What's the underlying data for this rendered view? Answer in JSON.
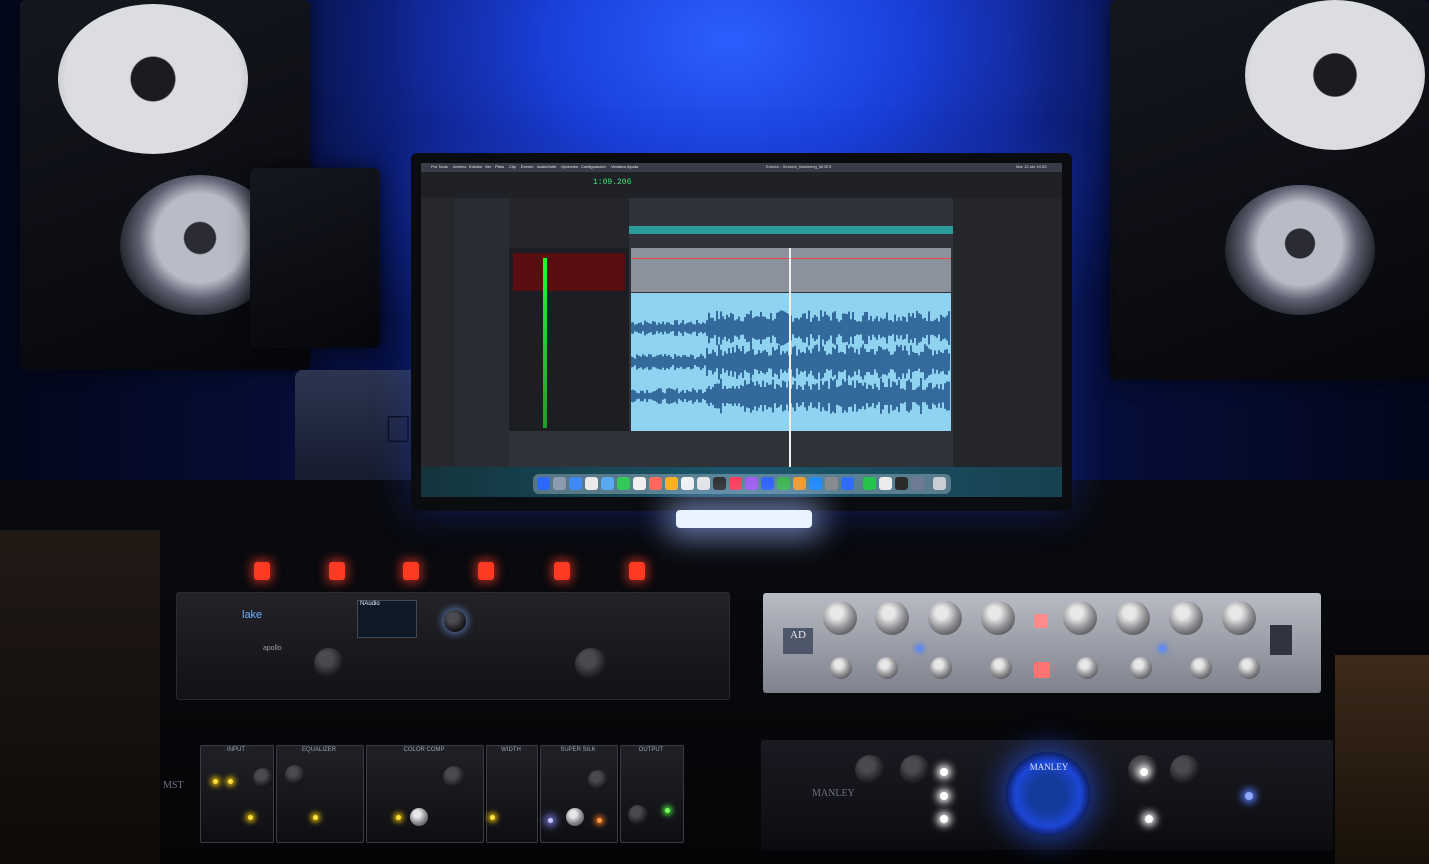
{
  "screen": {
    "menu_items": [
      "Pro Tools",
      "Archivo",
      "Edición",
      "Ver",
      "Pista",
      "Clip",
      "Evento",
      "AudioSuite",
      "Opciones",
      "Configuración",
      "Ventana",
      "Ayuda"
    ],
    "session_title": "Edición - Session_Mastering_MIXES",
    "counter": "1:09.206",
    "status_right": "Mar 12 abr 19:53"
  },
  "hardware": {
    "lake_logo": "lake",
    "lcd_brand": "NAudio",
    "apollo_label": "apollo",
    "ad_logo": "AD",
    "manley_vu": "MANLEY",
    "manley_logo": "MANLEY",
    "msp_label": "MST",
    "amp_sections": [
      "INPUT",
      "EQUALIZER",
      "COLOR COMP",
      "WIDTH",
      "SUPER SILK",
      "OUTPUT"
    ]
  },
  "colors": {
    "wall_glow": "#1a3fd9",
    "waveform": "#8fd3f0",
    "led_red": "#ff3a22",
    "vu_blue": "#1c46d6"
  }
}
